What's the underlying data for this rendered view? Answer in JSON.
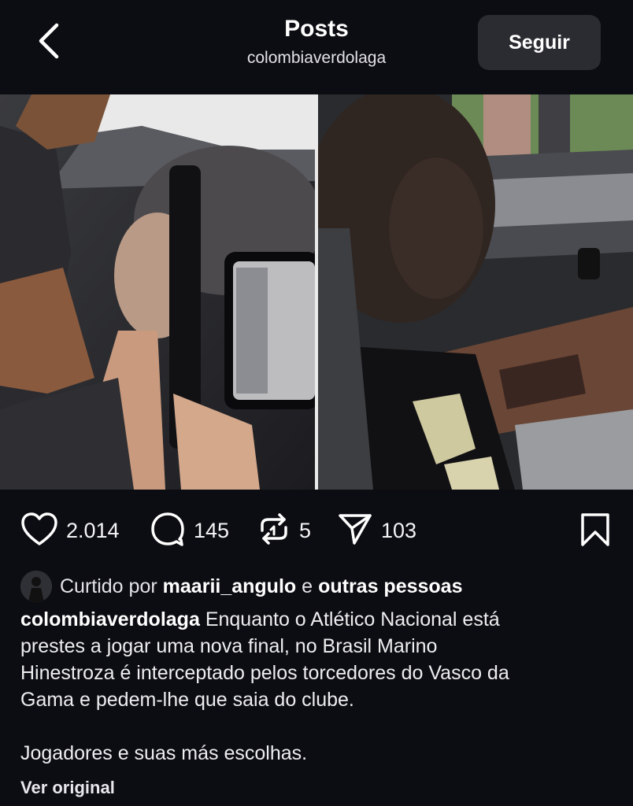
{
  "header": {
    "title": "Posts",
    "subtitle": "colombiaverdolaga",
    "follow_label": "Seguir"
  },
  "media": {
    "images": [
      "photo-left",
      "photo-right"
    ]
  },
  "actions": {
    "likes": "2.014",
    "comments": "145",
    "reposts": "5",
    "shares": "103",
    "icons": [
      "heart-icon",
      "comment-icon",
      "repost-icon",
      "share-icon",
      "bookmark-icon"
    ]
  },
  "liked_by": {
    "prefix": "Curtido por",
    "user": "maarii_angulo",
    "conjunction": "e",
    "others": "outras pessoas"
  },
  "caption": {
    "username": "colombiaverdolaga",
    "line1": "Enquanto o Atlético Nacional está",
    "line2": "prestes a jogar uma nova final, no Brasil Marino",
    "line3": "Hinestroza é interceptado pelos torcedores do Vasco da",
    "line4": "Gama e pedem-lhe que saia do clube.",
    "line5": "Jogadores e suas más escolhas."
  },
  "see_original_label": "Ver original",
  "colors": {
    "background": "#0c0d12",
    "button": "#2b2c31",
    "text": "#ffffff"
  }
}
